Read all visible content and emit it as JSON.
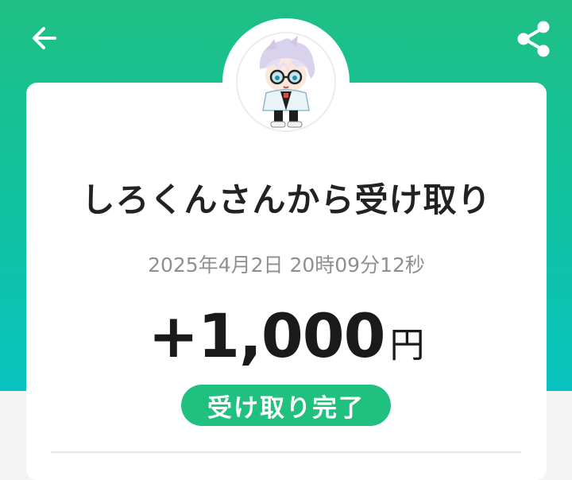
{
  "header": {
    "back_icon": "arrow-left-icon",
    "share_icon": "share-icon",
    "colors": {
      "gradient_top": "#1fbf84",
      "gradient_bottom": "#08c3be"
    }
  },
  "sender": {
    "avatar_icon": "chibi-character-avatar"
  },
  "transaction": {
    "title": "しろくんさんから受け取り",
    "timestamp": "2025年4月2日 20時09分12秒",
    "amount": "+1,000",
    "currency": "円",
    "status": "受け取り完了",
    "status_color": "#20c07e"
  }
}
